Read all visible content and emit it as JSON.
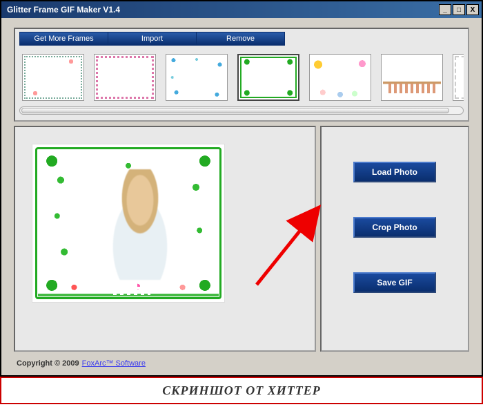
{
  "window": {
    "title": "Glitter Frame GIF Maker V1.4",
    "controls": {
      "min": "_",
      "max": "□",
      "close": "X"
    }
  },
  "tabs": {
    "get_more": "Get More Frames",
    "import": "Import",
    "remove": "Remove"
  },
  "thumbnails": {
    "selected_index": 3
  },
  "actions": {
    "load": "Load Photo",
    "crop": "Crop Photo",
    "save": "Save GIF"
  },
  "footer": {
    "copyright": "Copyright © 2009",
    "link_text": "FoxArc™ Software"
  },
  "banner": {
    "text": "СКРИНШОТ ОТ ХИТТЕР"
  }
}
